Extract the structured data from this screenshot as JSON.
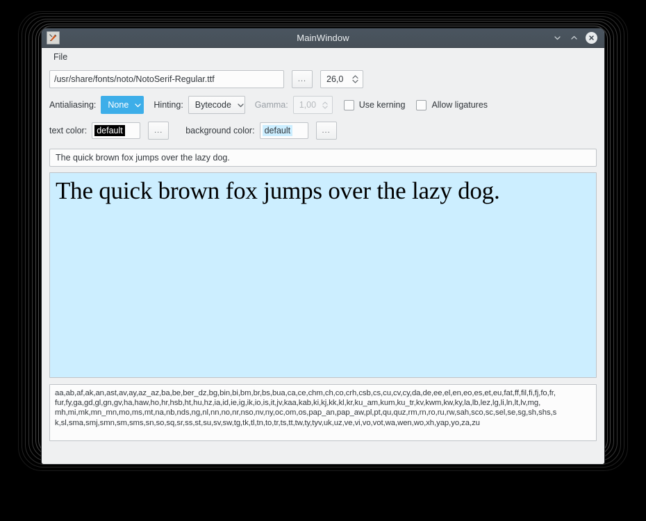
{
  "window": {
    "title": "MainWindow",
    "icon_name": "app-icon",
    "buttons": {
      "minimize": "minimize",
      "maximize": "maximize",
      "close": "close"
    }
  },
  "menubar": {
    "items": [
      {
        "label": "File"
      }
    ]
  },
  "font_row": {
    "path_value": "/usr/share/fonts/noto/NotoSerif-Regular.ttf",
    "browse_label": "...",
    "size_value": "26,0"
  },
  "options_row": {
    "antialiasing_label": "Antialiasing:",
    "antialiasing_value": "None",
    "hinting_label": "Hinting:",
    "hinting_value": "Bytecode",
    "gamma_label": "Gamma:",
    "gamma_value": "1,00",
    "use_kerning_label": "Use kerning",
    "use_kerning_checked": false,
    "allow_ligatures_label": "Allow ligatures",
    "allow_ligatures_checked": false
  },
  "color_row": {
    "text_color_label": "text color:",
    "text_color_value": "default",
    "text_color_browse": "...",
    "background_color_label": "background color:",
    "background_color_value": "default",
    "background_color_browse": "..."
  },
  "preview": {
    "input_value": "The quick brown fox jumps over the lazy dog.",
    "rendered_text": "The quick brown fox jumps over the lazy dog."
  },
  "languages": {
    "lines": [
      "aa,ab,af,ak,an,ast,av,ay,az_az,ba,be,ber_dz,bg,bin,bi,bm,br,bs,bua,ca,ce,chm,ch,co,crh,csb,cs,cu,cv,cy,da,de,ee,el,en,eo,es,et,eu,fat,ff,fil,fi,fj,fo,fr,",
      "fur,fy,ga,gd,gl,gn,gv,ha,haw,ho,hr,hsb,ht,hu,hz,ia,id,ie,ig,ik,io,is,it,jv,kaa,kab,ki,kj,kk,kl,kr,ku_am,kum,ku_tr,kv,kwm,kw,ky,la,lb,lez,lg,li,ln,lt,lv,mg,",
      "mh,mi,mk,mn_mn,mo,ms,mt,na,nb,nds,ng,nl,nn,no,nr,nso,nv,ny,oc,om,os,pap_an,pap_aw,pl,pt,qu,quz,rm,rn,ro,ru,rw,sah,sco,sc,sel,se,sg,sh,shs,s",
      "k,sl,sma,smj,smn,sm,sms,sn,so,sq,sr,ss,st,su,sv,sw,tg,tk,tl,tn,to,tr,ts,tt,tw,ty,tyv,uk,uz,ve,vi,vo,vot,wa,wen,wo,xh,yap,yo,za,zu"
    ]
  },
  "colors": {
    "titlebar": "#475058",
    "window_bg": "#eff0f1",
    "accent_selection": "#3daee9",
    "render_bg": "#cceeff",
    "render_fg": "#000000",
    "text_color_swatch_bg": "#000000",
    "text_color_swatch_fg": "#ffffff",
    "background_color_swatch_bg": "#cceeff",
    "background_color_swatch_fg": "#31363b",
    "field_border": "#bfc3c7"
  }
}
